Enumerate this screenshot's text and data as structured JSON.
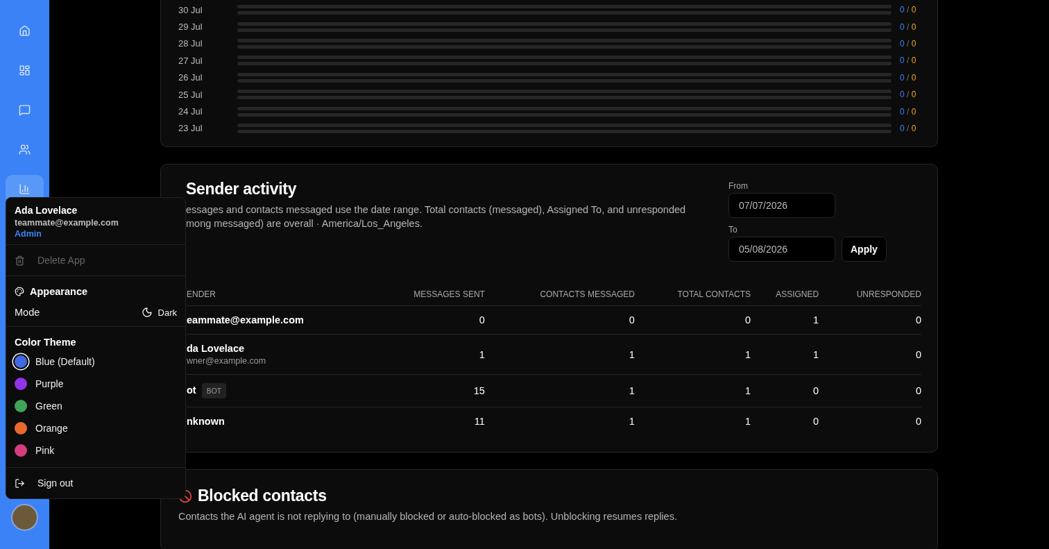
{
  "sidebar": {
    "items": [
      {
        "selected": false
      },
      {
        "selected": false
      },
      {
        "selected": false
      },
      {
        "selected": false
      },
      {
        "selected": true
      }
    ]
  },
  "daily_activity": {
    "rows": [
      {
        "date": "30 Jul",
        "sent": "0",
        "received": "0"
      },
      {
        "date": "29 Jul",
        "sent": "0",
        "received": "0"
      },
      {
        "date": "28 Jul",
        "sent": "0",
        "received": "0"
      },
      {
        "date": "27 Jul",
        "sent": "0",
        "received": "0"
      },
      {
        "date": "26 Jul",
        "sent": "0",
        "received": "0"
      },
      {
        "date": "25 Jul",
        "sent": "0",
        "received": "0"
      },
      {
        "date": "24 Jul",
        "sent": "0",
        "received": "0"
      },
      {
        "date": "23 Jul",
        "sent": "0",
        "received": "0"
      }
    ],
    "separator": "/"
  },
  "sender_activity": {
    "title": "Sender activity",
    "description_lines": [
      "essages and contacts messaged use the date range. Total contacts (messaged), Assigned To, and unresponded",
      "mong messaged) are overall · America/Los_Angeles."
    ],
    "from": {
      "label": "From",
      "value": "07/07/2026"
    },
    "to": {
      "label": "To",
      "value": "05/08/2026"
    },
    "apply": "Apply",
    "columns": [
      "ENDER",
      "MESSAGES SENT",
      "CONTACTS MESSAGED",
      "TOTAL CONTACTS",
      "ASSIGNED",
      "UNRESPONDED"
    ],
    "rows": [
      {
        "sender": "eammate@example.com",
        "values": [
          "0",
          "0",
          "0",
          "1",
          "0"
        ]
      },
      {
        "sender": "da Lovelace",
        "subtitle": "wner@example.com",
        "values": [
          "1",
          "1",
          "1",
          "1",
          "0"
        ]
      },
      {
        "sender": "ot",
        "badge": "BOT",
        "values": [
          "15",
          "1",
          "1",
          "0",
          "0"
        ]
      },
      {
        "sender": "nknown",
        "values": [
          "11",
          "1",
          "1",
          "0",
          "0"
        ]
      }
    ]
  },
  "blocked_contacts": {
    "title": "Blocked contacts",
    "description": "Contacts the AI agent is not replying to (manually blocked or auto-blocked as bots). Unblocking resumes replies."
  },
  "user_menu": {
    "name": "Ada Lovelace",
    "email": "teammate@example.com",
    "role": "Admin",
    "delete_app": {
      "label": "Delete App",
      "disabled": true
    },
    "appearance": "Appearance",
    "mode_label": "Mode",
    "mode_value": "Dark",
    "color_theme": "Color Theme",
    "themes": [
      {
        "label": "Blue (Default)",
        "color": "#4169e1",
        "selected": true
      },
      {
        "label": "Purple",
        "color": "#9333ea",
        "selected": false
      },
      {
        "label": "Green",
        "color": "#3fa35a",
        "selected": false
      },
      {
        "label": "Orange",
        "color": "#e8692c",
        "selected": false
      },
      {
        "label": "Pink",
        "color": "#d63d7e",
        "selected": false
      }
    ],
    "sign_out": "Sign out"
  }
}
